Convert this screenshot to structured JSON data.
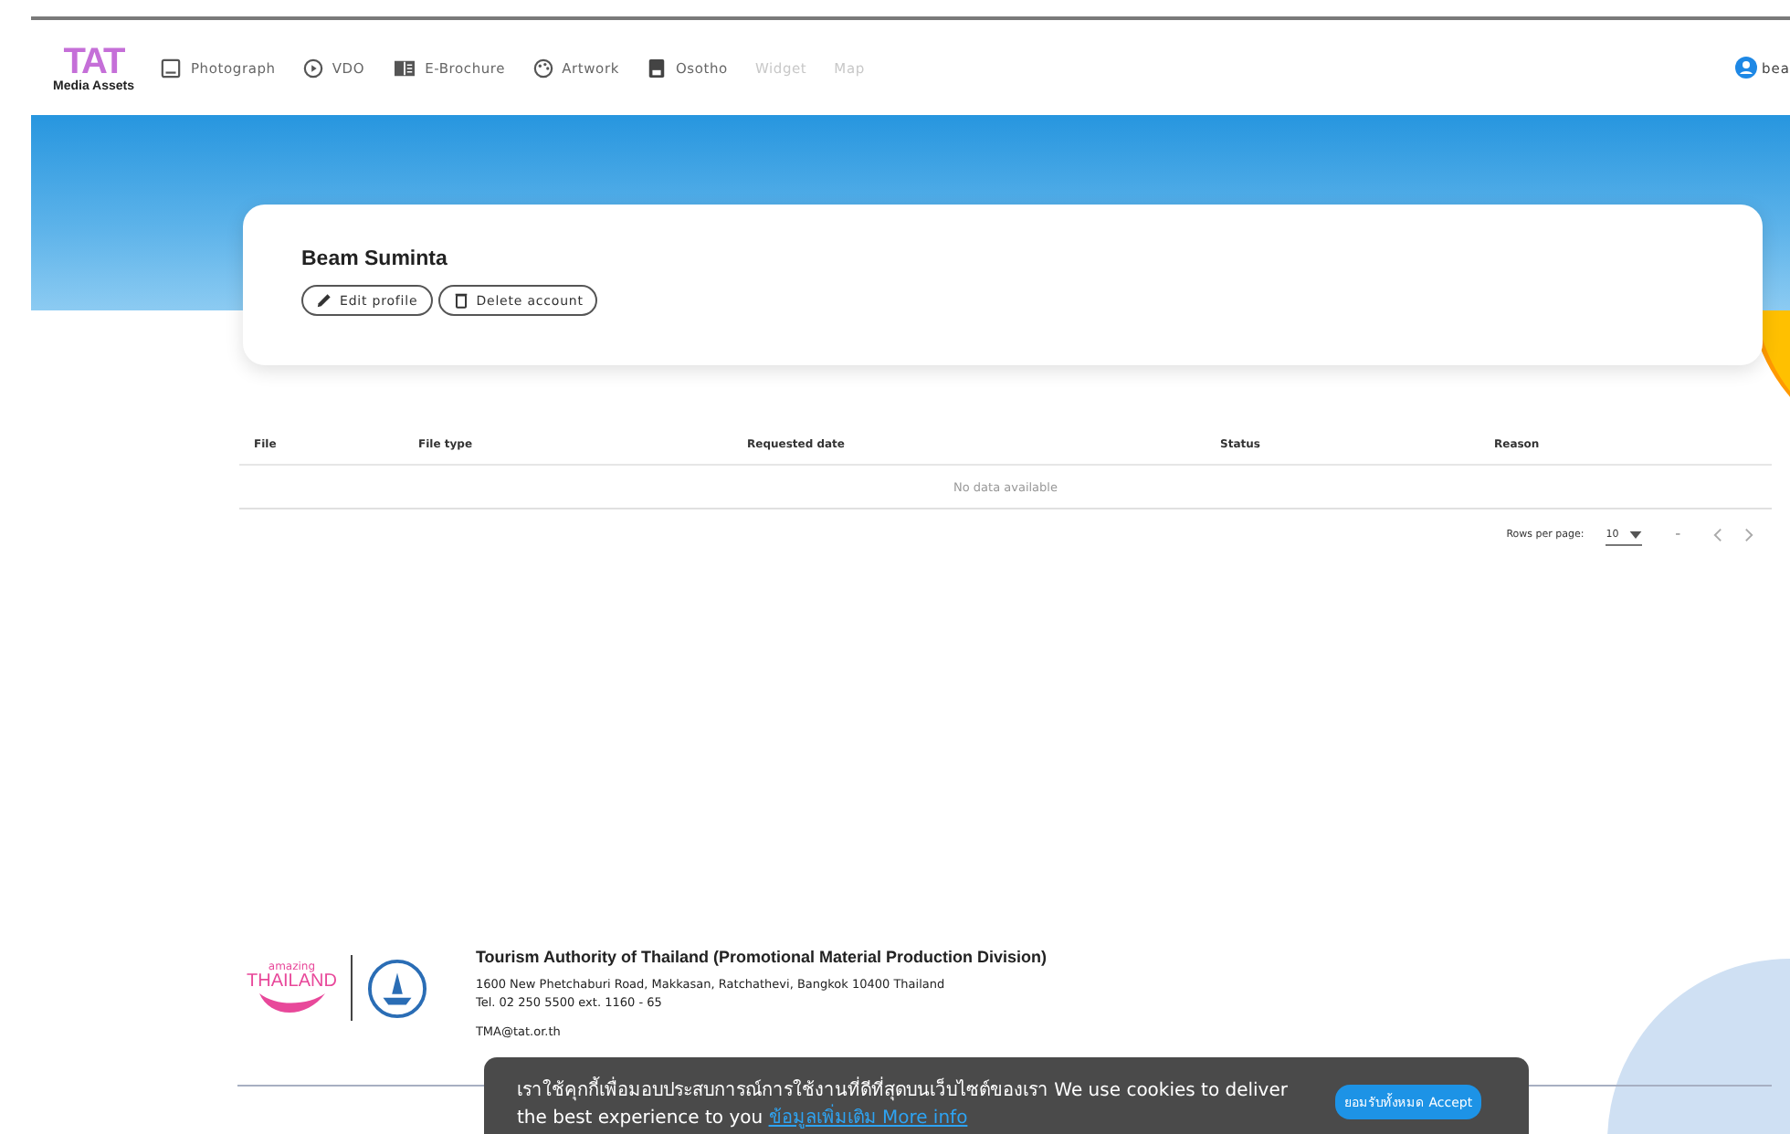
{
  "logo": {
    "mark": "TAT",
    "caption": "Media Assets"
  },
  "nav": [
    {
      "label": "Photograph",
      "kind": "image",
      "disabled": false
    },
    {
      "label": "VDO",
      "kind": "play",
      "disabled": false
    },
    {
      "label": "E-Brochure",
      "kind": "book",
      "disabled": false
    },
    {
      "label": "Artwork",
      "kind": "palette",
      "disabled": false
    },
    {
      "label": "Osotho",
      "kind": "doc",
      "disabled": false
    },
    {
      "label": "Widget",
      "kind": "text",
      "disabled": true
    },
    {
      "label": "Map",
      "kind": "text",
      "disabled": true
    }
  ],
  "user": {
    "name": "bea"
  },
  "profile": {
    "name": "Beam Suminta",
    "buttons": [
      {
        "label": "Edit profile",
        "kind": "edit"
      },
      {
        "label": "Delete account",
        "kind": "delete"
      }
    ]
  },
  "table": {
    "columns": [
      "File",
      "File type",
      "Requested date",
      "Status",
      "Reason"
    ],
    "empty_text": "No data available",
    "rows_per_page_label": "Rows per page:",
    "rows_per_page": "10",
    "page_range": "–"
  },
  "footer": {
    "brand_small": "amazing",
    "brand_big": "THAILAND",
    "org": "Tourism Authority of Thailand (Promotional Material Production Division)",
    "address": "1600 New Phetchaburi Road, Makkasan, Ratchathevi, Bangkok 10400 Thailand",
    "tel": "Tel. 02 250 5500 ext. 1160 - 65",
    "email": "TMA@tat.or.th"
  },
  "cookie": {
    "text": "เราใช้คุกกี้เพื่อมอบประสบการณ์การใช้งานที่ดีที่สุดบนเว็บไซต์ของเรา We use cookies to deliver the best experience to you",
    "link": "ข้อมูลเพิ่มเติม More info",
    "button": "ยอมรับทั้งหมด Accept"
  }
}
